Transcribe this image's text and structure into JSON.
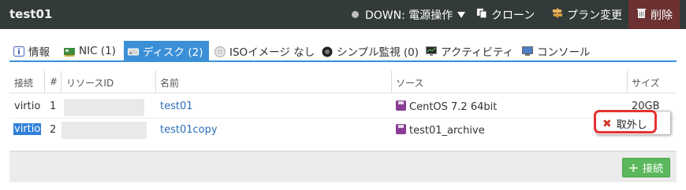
{
  "header": {
    "title": "test01",
    "power_status": "DOWN: 電源操作",
    "clone_label": "クローン",
    "plan_change_label": "プラン変更",
    "delete_label": "削除"
  },
  "tabs": [
    {
      "label": "情報"
    },
    {
      "label": "NIC (1)"
    },
    {
      "label": "ディスク (2)"
    },
    {
      "label": "ISOイメージ なし"
    },
    {
      "label": "シンプル監視 (0)"
    },
    {
      "label": "アクティビティ"
    },
    {
      "label": "コンソール"
    }
  ],
  "table": {
    "columns": [
      "接続",
      "#",
      "リソースID",
      "名前",
      "ソース",
      "サイズ"
    ],
    "rows": [
      {
        "connection": "virtio",
        "index": "1",
        "name": "test01",
        "source": "CentOS 7.2 64bit",
        "size": "20GB"
      },
      {
        "connection": "virtio",
        "index": "2",
        "name": "test01copy",
        "source": "test01_archive",
        "size": ""
      }
    ]
  },
  "popup": {
    "detach_label": "取外し"
  },
  "footer": {
    "connect_label": "接続"
  },
  "colors": {
    "accent": "#3b8fd6",
    "header_bg": "#333a3a",
    "delete_bg": "#6d3131",
    "connect_green": "#5cb85c",
    "highlight_red": "#e53131"
  }
}
